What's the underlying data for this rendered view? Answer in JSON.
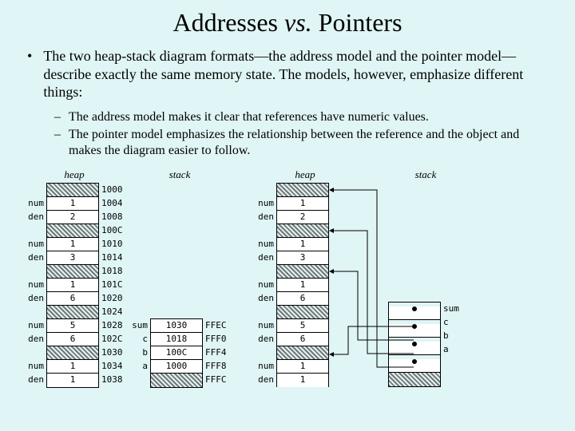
{
  "title_parts": {
    "a": "Addresses ",
    "vs": "vs.",
    "b": " Pointers"
  },
  "main_bullet": "The two heap-stack diagram formats—the address model and the pointer model—describe exactly the same memory state. The models, however, emphasize different things:",
  "sub_bullets": [
    "The address model makes it clear that references have numeric values.",
    "The pointer model emphasizes the relationship between the reference and the object and makes the diagram easier to follow."
  ],
  "labels": {
    "heap": "heap",
    "stack": "stack"
  },
  "address_heap": {
    "rows": [
      {
        "label": "",
        "value": "HATCH",
        "addr": "1000"
      },
      {
        "label": "num",
        "value": "1",
        "addr": "1004"
      },
      {
        "label": "den",
        "value": "2",
        "addr": "1008"
      },
      {
        "label": "",
        "value": "HATCH",
        "addr": "100C"
      },
      {
        "label": "num",
        "value": "1",
        "addr": "1010"
      },
      {
        "label": "den",
        "value": "3",
        "addr": "1014"
      },
      {
        "label": "",
        "value": "HATCH",
        "addr": "1018"
      },
      {
        "label": "num",
        "value": "1",
        "addr": "101C"
      },
      {
        "label": "den",
        "value": "6",
        "addr": "1020"
      },
      {
        "label": "",
        "value": "HATCH",
        "addr": "1024"
      },
      {
        "label": "num",
        "value": "5",
        "addr": "1028"
      },
      {
        "label": "den",
        "value": "6",
        "addr": "102C"
      },
      {
        "label": "",
        "value": "HATCH",
        "addr": "1030"
      },
      {
        "label": "num",
        "value": "1",
        "addr": "1034"
      },
      {
        "label": "den",
        "value": "1",
        "addr": "1038"
      }
    ]
  },
  "address_stack": {
    "rows": [
      {
        "label": "sum",
        "value": "1030",
        "addr": "FFEC"
      },
      {
        "label": "c",
        "value": "1018",
        "addr": "FFF0"
      },
      {
        "label": "b",
        "value": "100C",
        "addr": "FFF4"
      },
      {
        "label": "a",
        "value": "1000",
        "addr": "FFF8"
      },
      {
        "label": "",
        "value": "HATCH",
        "addr": "FFFC"
      }
    ]
  },
  "pointer_heap": {
    "rows": [
      {
        "label": "",
        "value": "HATCH"
      },
      {
        "label": "num",
        "value": "1"
      },
      {
        "label": "den",
        "value": "2"
      },
      {
        "label": "",
        "value": "HATCH"
      },
      {
        "label": "num",
        "value": "1"
      },
      {
        "label": "den",
        "value": "3"
      },
      {
        "label": "",
        "value": "HATCH"
      },
      {
        "label": "num",
        "value": "1"
      },
      {
        "label": "den",
        "value": "6"
      },
      {
        "label": "",
        "value": "HATCH"
      },
      {
        "label": "num",
        "value": "5"
      },
      {
        "label": "den",
        "value": "6"
      },
      {
        "label": "",
        "value": "HATCH"
      },
      {
        "label": "num",
        "value": "1"
      },
      {
        "label": "den",
        "value": "1"
      }
    ]
  },
  "pointer_stack": {
    "rows": [
      {
        "rlabel": "sum"
      },
      {
        "rlabel": "c"
      },
      {
        "rlabel": "b"
      },
      {
        "rlabel": "a"
      },
      {
        "rlabel": "",
        "hatch": true
      }
    ]
  }
}
